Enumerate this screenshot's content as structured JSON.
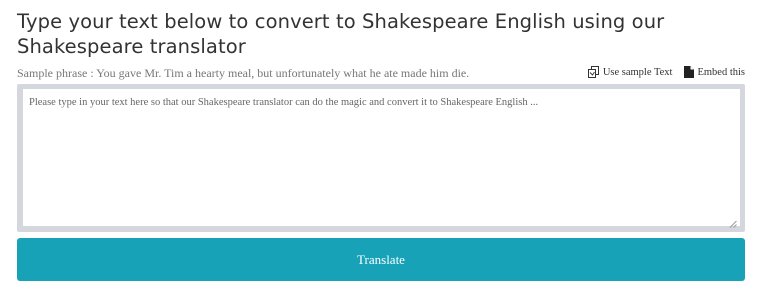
{
  "heading": "Type your text below to convert to Shakespeare English using our Shakespeare translator",
  "sample": {
    "phrase": "Sample phrase : You gave Mr. Tim a hearty meal, but unfortunately what he ate made him die.",
    "use_sample_label": "Use sample Text",
    "use_sample_icon": "copy-icon",
    "embed_label": "Embed this",
    "embed_icon": "file-icon"
  },
  "input": {
    "value": "",
    "placeholder": "Please type in your text here so that our Shakespeare translator can do the magic and convert it to Shakespeare English ..."
  },
  "translate_button": {
    "label": "Translate",
    "color": "#17a2b8"
  }
}
